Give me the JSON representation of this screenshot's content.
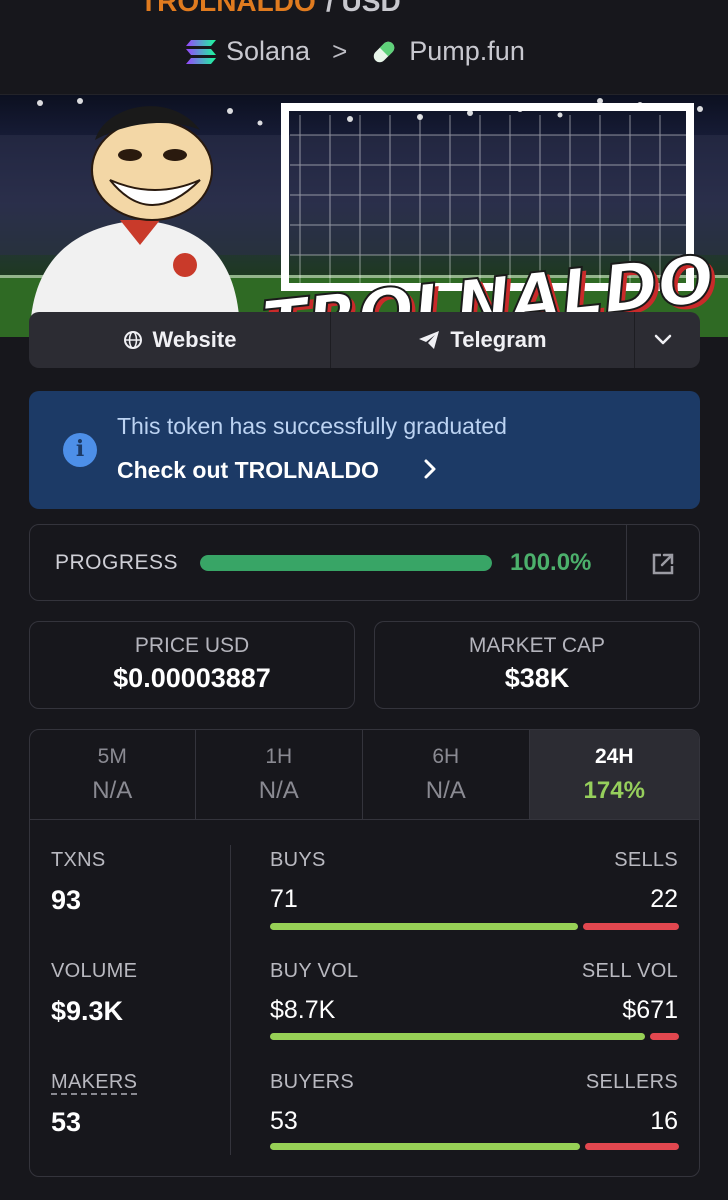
{
  "header": {
    "cut_title": "TROLNALDO",
    "cut_pair": "/ USD",
    "chain": "Solana",
    "separator": ">",
    "dex": "Pump.fun"
  },
  "banner": {
    "title": "TROLNALDO"
  },
  "links": {
    "website": "Website",
    "telegram": "Telegram"
  },
  "graduated": {
    "message": "This token has successfully graduated",
    "cta": "Check out TROLNALDO"
  },
  "progress": {
    "label": "PROGRESS",
    "value_text": "100.0%",
    "fraction": 1.0
  },
  "price": {
    "label": "PRICE USD",
    "value": "$0.00003887"
  },
  "market_cap": {
    "label": "MARKET CAP",
    "value": "$38K"
  },
  "tabs": [
    {
      "name": "5M",
      "value": "N/A"
    },
    {
      "name": "1H",
      "value": "N/A"
    },
    {
      "name": "6H",
      "value": "N/A"
    },
    {
      "name": "24H",
      "value": "174%",
      "active": true
    }
  ],
  "stats": {
    "txns": {
      "label": "TXNS",
      "value": "93"
    },
    "volume": {
      "label": "VOLUME",
      "value": "$9.3K"
    },
    "makers": {
      "label": "MAKERS",
      "value": "53"
    },
    "buys": {
      "label": "BUYS",
      "value": "71",
      "count": 71
    },
    "sells": {
      "label": "SELLS",
      "value": "22",
      "count": 22
    },
    "buy_vol": {
      "label": "BUY VOL",
      "value": "$8.7K",
      "amount": 8700
    },
    "sell_vol": {
      "label": "SELL VOL",
      "value": "$671",
      "amount": 671
    },
    "buyers": {
      "label": "BUYERS",
      "value": "53",
      "count": 53
    },
    "sellers": {
      "label": "SELLERS",
      "value": "16",
      "count": 16
    }
  },
  "colors": {
    "background": "#17171c",
    "graduated_bg": "#1c3a66",
    "progress_green": "#38a566",
    "buy_green": "#97d156",
    "sell_red": "#e2474f",
    "active_change": "#96cf5c"
  },
  "icons": [
    "solana-icon",
    "pill-icon",
    "globe-icon",
    "telegram-icon",
    "chevron-down-icon",
    "info-icon",
    "chevron-right-icon",
    "external-link-icon"
  ]
}
